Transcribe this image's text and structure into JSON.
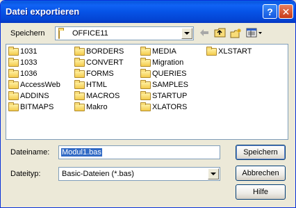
{
  "window": {
    "title": "Datei exportieren"
  },
  "titlebar": {
    "help_glyph": "?",
    "close_glyph": "✕"
  },
  "location": {
    "label": "Speichern",
    "current_folder": "OFFICE11"
  },
  "folders": [
    "1031",
    "1033",
    "1036",
    "AccessWeb",
    "ADDINS",
    "BITMAPS",
    "BORDERS",
    "CONVERT",
    "FORMS",
    "HTML",
    "MACROS",
    "Makro",
    "MEDIA",
    "Migration",
    "QUERIES",
    "SAMPLES",
    "STARTUP",
    "XLATORS",
    "XLSTART"
  ],
  "filename": {
    "label": "Dateiname:",
    "value": "Modul1.bas"
  },
  "filetype": {
    "label": "Dateityp:",
    "value": "Basic-Dateien (*.bas)"
  },
  "buttons": {
    "save": "Speichern",
    "cancel": "Abbrechen",
    "help": "Hilfe"
  },
  "colors": {
    "titlebar": "#0653e6",
    "selection": "#316ac5",
    "face": "#ece9d8"
  }
}
